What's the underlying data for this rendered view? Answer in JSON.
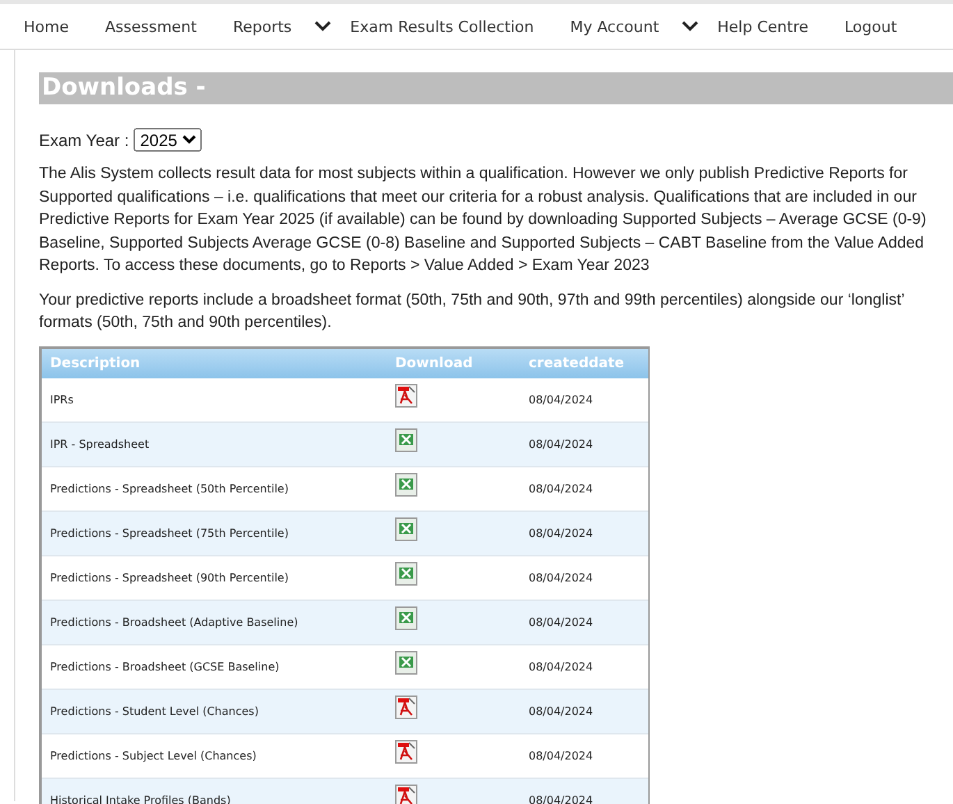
{
  "nav": [
    {
      "label": "Home",
      "dropdown": false
    },
    {
      "label": "Assessment",
      "dropdown": false
    },
    {
      "label": "Reports",
      "dropdown": true
    },
    {
      "label": "Exam Results Collection",
      "dropdown": false
    },
    {
      "label": "My Account",
      "dropdown": true
    },
    {
      "label": "Help Centre",
      "dropdown": false
    },
    {
      "label": "Logout",
      "dropdown": false
    }
  ],
  "heading": "Downloads -",
  "exam_year": {
    "label": "Exam Year :",
    "value": "2025"
  },
  "paragraphs": [
    "The Alis System collects result data for most subjects within a qualification. However we only publish Predictive Reports for Supported qualifications – i.e. qualifications that meet our criteria for a robust analysis. Qualifications that are included in our Predictive Reports for Exam Year 2025  (if available) can be found by downloading Supported Subjects – Average GCSE (0-9) Baseline, Supported Subjects Average GCSE (0-8) Baseline and Supported Subjects – CABT Baseline from the Value Added Reports. To access these documents, go to Reports > Value Added > Exam Year 2023",
    "Your predictive reports include a broadsheet format (50th, 75th and 90th, 97th and 99th percentiles) alongside our ‘longlist’ formats (50th, 75th and 90th percentiles)."
  ],
  "table": {
    "columns": [
      "Description",
      "Download",
      "createddate"
    ],
    "rows": [
      {
        "description": "IPRs",
        "kind": "pdf",
        "date": "08/04/2024"
      },
      {
        "description": "IPR - Spreadsheet",
        "kind": "excel",
        "date": "08/04/2024"
      },
      {
        "description": "Predictions - Spreadsheet (50th Percentile)",
        "kind": "excel",
        "date": "08/04/2024"
      },
      {
        "description": "Predictions - Spreadsheet (75th Percentile)",
        "kind": "excel",
        "date": "08/04/2024"
      },
      {
        "description": "Predictions - Spreadsheet (90th Percentile)",
        "kind": "excel",
        "date": "08/04/2024"
      },
      {
        "description": "Predictions - Broadsheet (Adaptive Baseline)",
        "kind": "excel",
        "date": "08/04/2024"
      },
      {
        "description": "Predictions - Broadsheet (GCSE Baseline)",
        "kind": "excel",
        "date": "08/04/2024"
      },
      {
        "description": "Predictions - Student Level (Chances)",
        "kind": "pdf",
        "date": "08/04/2024"
      },
      {
        "description": "Predictions - Subject Level (Chances)",
        "kind": "pdf",
        "date": "08/04/2024"
      },
      {
        "description": "Historical Intake Profiles (Bands)",
        "kind": "pdf",
        "date": "08/04/2024"
      }
    ]
  }
}
